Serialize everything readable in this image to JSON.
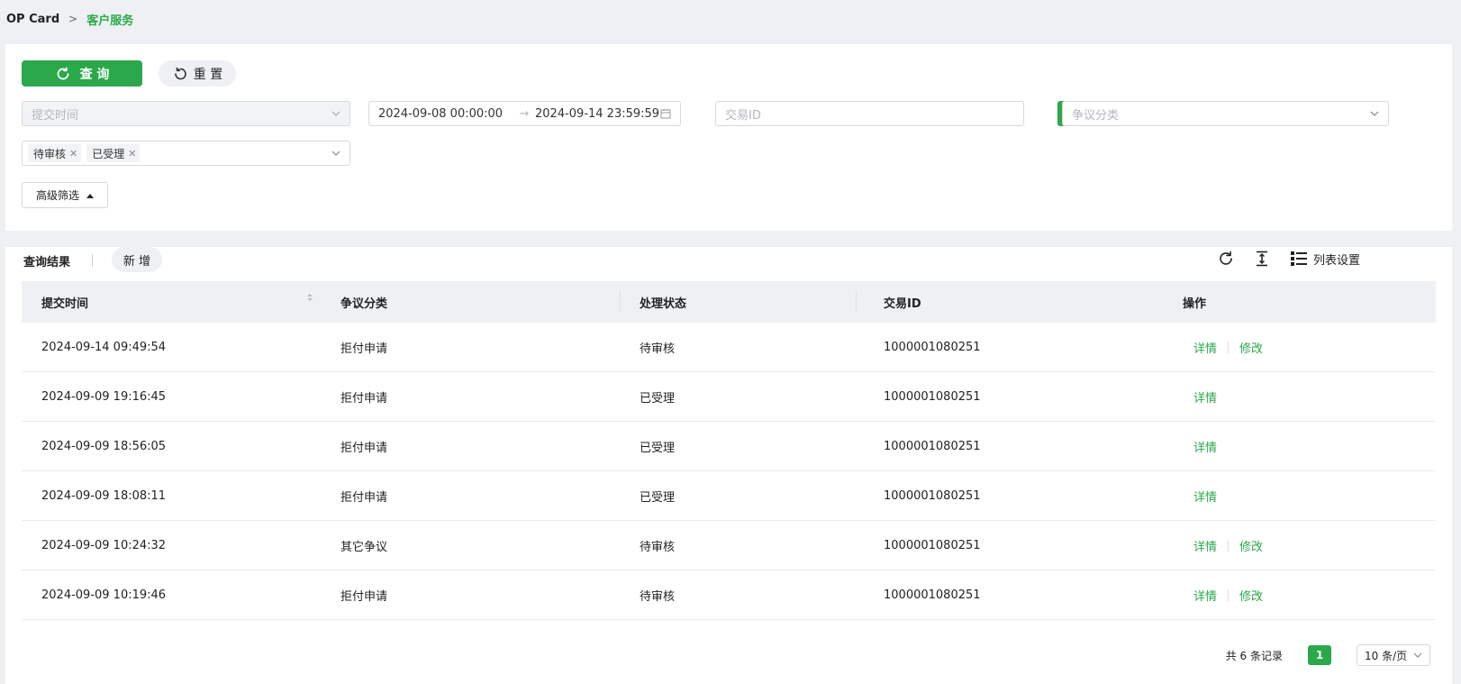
{
  "breadcrumb": {
    "root": "OP Card",
    "current": "客户服务"
  },
  "filters": {
    "query_label": "查 询",
    "reset_label": "重 置",
    "submit_time_placeholder": "提交时间",
    "date_start": "2024-09-08 00:00:00",
    "date_arrow": "→",
    "date_end": "2024-09-14 23:59:59",
    "transaction_id_placeholder": "交易ID",
    "dispute_category_placeholder": "争议分类",
    "status_tags": [
      "待审核",
      "已受理"
    ],
    "advanced_label": "高级筛选"
  },
  "results": {
    "title": "查询结果",
    "new_label": "新 增",
    "list_settings_label": "列表设置",
    "columns": [
      "提交时间",
      "争议分类",
      "处理状态",
      "交易ID",
      "操作"
    ],
    "rows": [
      {
        "time": "2024-09-14 09:49:54",
        "category": "拒付申请",
        "status": "待审核",
        "txid": "1000001080251",
        "actions": [
          "详情",
          "修改"
        ]
      },
      {
        "time": "2024-09-09 19:16:45",
        "category": "拒付申请",
        "status": "已受理",
        "txid": "1000001080251",
        "actions": [
          "详情"
        ]
      },
      {
        "time": "2024-09-09 18:56:05",
        "category": "拒付申请",
        "status": "已受理",
        "txid": "1000001080251",
        "actions": [
          "详情"
        ]
      },
      {
        "time": "2024-09-09 18:08:11",
        "category": "拒付申请",
        "status": "已受理",
        "txid": "1000001080251",
        "actions": [
          "详情"
        ]
      },
      {
        "time": "2024-09-09 10:24:32",
        "category": "其它争议",
        "status": "待审核",
        "txid": "1000001080251",
        "actions": [
          "详情",
          "修改"
        ]
      },
      {
        "time": "2024-09-09 10:19:46",
        "category": "拒付申请",
        "status": "待审核",
        "txid": "1000001080251",
        "actions": [
          "详情",
          "修改"
        ]
      }
    ]
  },
  "pagination": {
    "total": "共 6 条记录",
    "current_page": "1",
    "page_size": "10 条/页"
  },
  "colors": {
    "accent": "#2aa84a",
    "header_bg": "#eef0f3",
    "page_bg": "#eef0f3"
  },
  "icons": [
    "refresh-icon",
    "reset-icon",
    "chevron-down-icon",
    "calendar-icon",
    "plus-circle-icon",
    "close-icon",
    "caret-up-icon",
    "reload-icon",
    "column-height-icon",
    "list-settings-icon",
    "sort-icon"
  ]
}
